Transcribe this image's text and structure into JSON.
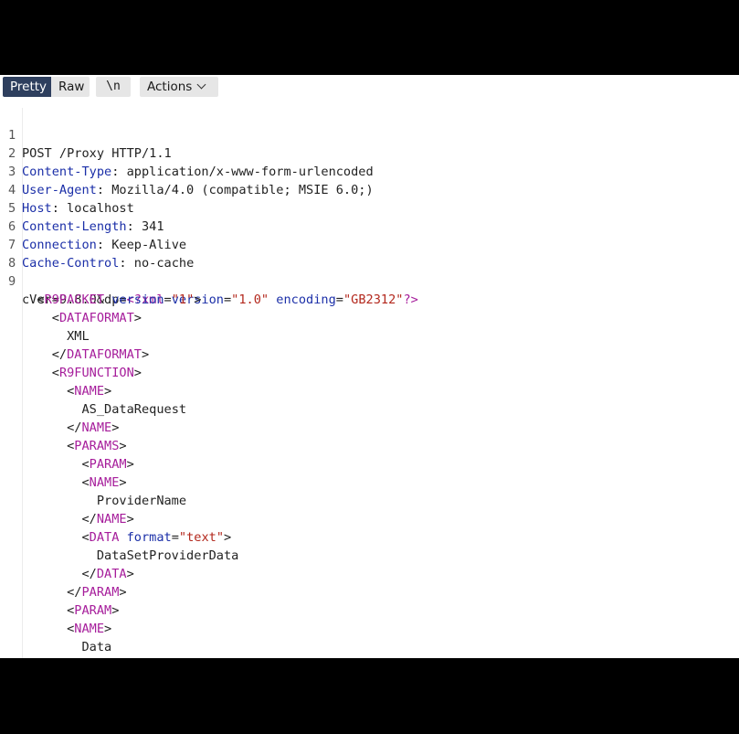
{
  "toolbar": {
    "tabs": [
      "Pretty",
      "Raw",
      "\\n"
    ],
    "actions_label": "Actions"
  },
  "request": {
    "line1": "POST /Proxy HTTP/1.1",
    "headers": [
      {
        "name": "Content-Type",
        "value": "application/x-www-form-urlencoded"
      },
      {
        "name": "User-Agent",
        "value": "Mozilla/4.0 (compatible; MSIE 6.0;)"
      },
      {
        "name": "Host",
        "value": "localhost"
      },
      {
        "name": "Content-Length",
        "value": "341"
      },
      {
        "name": "Connection",
        "value": "Keep-Alive"
      },
      {
        "name": "Cache-Control",
        "value": "no-cache"
      }
    ],
    "body_prefix": "cVer=9.8.0&dp=",
    "xml_decl": {
      "version": "1.0",
      "encoding": "GB2312"
    },
    "xml": {
      "packet_tag": "R9PACKET",
      "packet_version": "1",
      "dataformat_tag": "DATAFORMAT",
      "dataformat_value": "XML",
      "function_tag": "R9FUNCTION",
      "name_tag": "NAME",
      "function_name": "AS_DataRequest",
      "params_tag": "PARAMS",
      "param_tag": "PARAM",
      "param1_name": "ProviderName",
      "data_tag": "DATA",
      "data_format": "text",
      "param1_data": "DataSetProviderData",
      "param2_name": "Data"
    }
  }
}
